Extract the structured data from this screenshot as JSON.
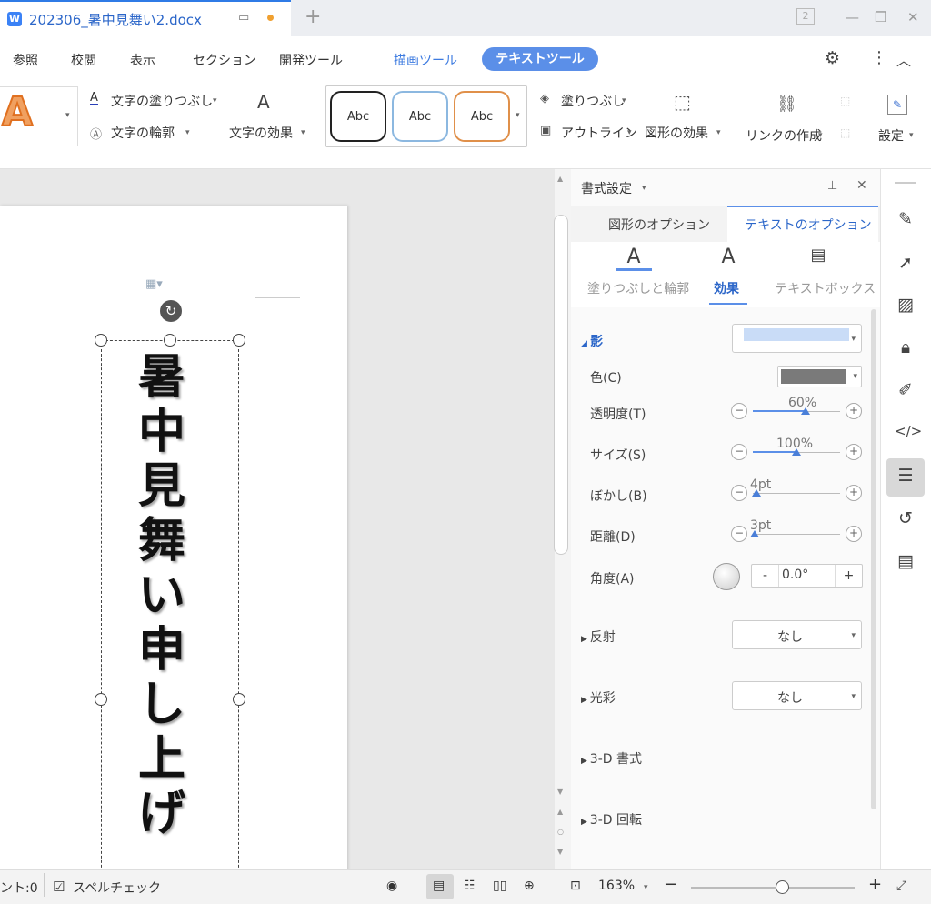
{
  "titlebar": {
    "doc_title": "202306_暑中見舞い2.docx",
    "app_logo": "W",
    "page_count_icon": "2"
  },
  "menu": {
    "items": [
      "参照",
      "校閲",
      "表示",
      "セクション",
      "開発ツール",
      "描画ツール"
    ],
    "active": "テキストツール"
  },
  "toolbar": {
    "fill_label": "文字の塗りつぶし",
    "outline_label": "文字の輪郭",
    "effect_label": "文字の効果",
    "styles": [
      "Abc",
      "Abc",
      "Abc"
    ],
    "shape_fill_label": "塗りつぶし",
    "shape_outline_label": "アウトライン",
    "shape_effect_label": "図形の効果",
    "link_label": "リンクの作成",
    "settings_label": "設定"
  },
  "document": {
    "vertical_text": "暑中見舞い申し上げ"
  },
  "panel": {
    "title": "書式設定",
    "tabs": [
      "図形のオプション",
      "テキストのオプション"
    ],
    "subtabs": [
      "塗りつぶしと輪郭",
      "効果",
      "テキストボックス"
    ],
    "shadow": {
      "section": "影",
      "color_label": "色(C)",
      "transparency_label": "透明度(T)",
      "transparency_value": "60%",
      "transparency_frac": 0.6,
      "size_label": "サイズ(S)",
      "size_value": "100%",
      "size_frac": 0.5,
      "blur_label": "ぼかし(B)",
      "blur_value": "4pt",
      "blur_frac": 0.04,
      "distance_label": "距離(D)",
      "distance_value": "3pt",
      "distance_frac": 0.02,
      "angle_label": "角度(A)",
      "angle_value": "0.0°"
    },
    "reflection": {
      "label": "反射",
      "value": "なし"
    },
    "glow": {
      "label": "光彩",
      "value": "なし"
    },
    "format3d": "3-D 書式",
    "rotation3d": "3-D 回転"
  },
  "statusbar": {
    "word_count": "ント:0",
    "spell_check": "スペルチェック",
    "zoom": "163%"
  },
  "colors": {
    "accent": "#5b8fe8",
    "shadow_color": "#7a7a7a",
    "preset_blue": "#c9dcf7"
  }
}
